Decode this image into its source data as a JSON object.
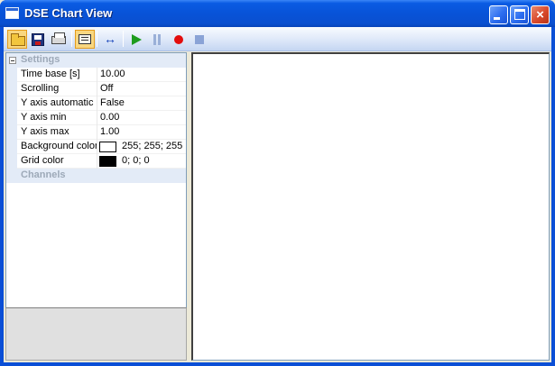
{
  "window": {
    "title": "DSE Chart View",
    "controls": {
      "minimize": "minimize",
      "maximize": "maximize",
      "close": "×"
    }
  },
  "toolbar": {
    "buttons": [
      {
        "name": "open",
        "icon": "folder-open-icon",
        "active": true
      },
      {
        "name": "save",
        "icon": "save-disk-icon"
      },
      {
        "name": "print",
        "icon": "printer-icon"
      },
      {
        "name": "view",
        "icon": "chart-view-icon",
        "active": true
      },
      {
        "name": "zoom",
        "icon": "double-arrow-icon",
        "glyph": "↔"
      },
      {
        "name": "play",
        "icon": "play-icon",
        "color": "#1e9c1e"
      },
      {
        "name": "pause",
        "icon": "pause-icon",
        "color": "#9ab0d8"
      },
      {
        "name": "record",
        "icon": "record-icon",
        "color": "#e30d0d"
      },
      {
        "name": "stop",
        "icon": "stop-icon",
        "color": "#8aa3d6"
      }
    ]
  },
  "properties": {
    "settings_label": "Settings",
    "channels_label": "Channels",
    "rows": [
      {
        "name": "Time base [s]",
        "value": "10.00"
      },
      {
        "name": "Scrolling",
        "value": "Off"
      },
      {
        "name": "Y axis automatic",
        "value": "False"
      },
      {
        "name": "Y axis min",
        "value": "0.00"
      },
      {
        "name": "Y axis max",
        "value": "1.00"
      },
      {
        "name": "Background color",
        "value": "255; 255; 255",
        "swatch": "#ffffff"
      },
      {
        "name": "Grid color",
        "value": "0; 0; 0",
        "swatch": "#000000"
      }
    ]
  }
}
